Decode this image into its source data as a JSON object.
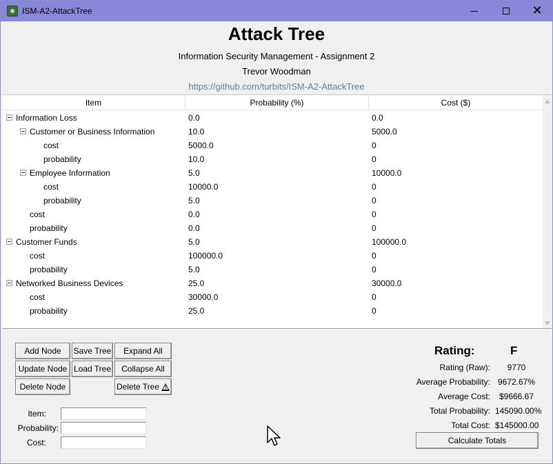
{
  "window": {
    "title": "ISM-A2-AttackTree"
  },
  "header": {
    "title": "Attack Tree",
    "subtitle": "Information Security Management - Assignment 2",
    "author": "Trevor Woodman",
    "link": "https://github.com/turbits/ISM-A2-AttackTree"
  },
  "tree": {
    "columns": [
      "Item",
      "Probability (%)",
      "Cost ($)"
    ],
    "rows": [
      {
        "item": "Information Loss",
        "prob": "0.0",
        "cost": "0.0",
        "level": 0,
        "expandable": true
      },
      {
        "item": "Customer or Business Information",
        "prob": "10.0",
        "cost": "5000.0",
        "level": 1,
        "expandable": true
      },
      {
        "item": "cost",
        "prob": "5000.0",
        "cost": "0",
        "level": 2,
        "expandable": false
      },
      {
        "item": "probability",
        "prob": "10.0",
        "cost": "0",
        "level": 2,
        "expandable": false
      },
      {
        "item": "Employee Information",
        "prob": "5.0",
        "cost": "10000.0",
        "level": 1,
        "expandable": true
      },
      {
        "item": "cost",
        "prob": "10000.0",
        "cost": "0",
        "level": 2,
        "expandable": false
      },
      {
        "item": "probability",
        "prob": "5.0",
        "cost": "0",
        "level": 2,
        "expandable": false
      },
      {
        "item": "cost",
        "prob": "0.0",
        "cost": "0",
        "level": 1,
        "expandable": false
      },
      {
        "item": "probability",
        "prob": "0.0",
        "cost": "0",
        "level": 1,
        "expandable": false
      },
      {
        "item": "Customer Funds",
        "prob": "5.0",
        "cost": "100000.0",
        "level": 0,
        "expandable": true
      },
      {
        "item": "cost",
        "prob": "100000.0",
        "cost": "0",
        "level": 1,
        "expandable": false
      },
      {
        "item": "probability",
        "prob": "5.0",
        "cost": "0",
        "level": 1,
        "expandable": false
      },
      {
        "item": "Networked Business Devices",
        "prob": "25.0",
        "cost": "30000.0",
        "level": 0,
        "expandable": true
      },
      {
        "item": "cost",
        "prob": "30000.0",
        "cost": "0",
        "level": 1,
        "expandable": false
      },
      {
        "item": "probability",
        "prob": "25.0",
        "cost": "0",
        "level": 1,
        "expandable": false
      }
    ]
  },
  "buttons": {
    "add_node": "Add Node",
    "save_tree": "Save Tree",
    "expand_all": "Expand All",
    "update_node": "Update Node",
    "load_tree": "Load Tree",
    "collapse_all": "Collapse All",
    "delete_node": "Delete Node",
    "delete_tree": "Delete Tree",
    "calculate_totals": "Calculate Totals"
  },
  "form": {
    "item_label": "Item:",
    "probability_label": "Probability:",
    "cost_label": "Cost:",
    "item_value": "",
    "probability_value": "",
    "cost_value": ""
  },
  "stats": {
    "rating_label": "Rating:",
    "rating_grade": "F",
    "rows": [
      {
        "label": "Rating (Raw):",
        "value": "9770"
      },
      {
        "label": "Average Probability:",
        "value": "9672.67%"
      },
      {
        "label": "Average Cost:",
        "value": "$9666.67"
      },
      {
        "label": "Total Probability:",
        "value": "145090.00%"
      },
      {
        "label": "Total Cost:",
        "value": "$145000.00"
      }
    ]
  },
  "icons": {
    "app": "app-icon",
    "minimize": "minimize-icon",
    "maximize": "maximize-icon",
    "close": "close-icon",
    "warning": "warning-icon",
    "collapse": "minus-box-icon",
    "cursor": "mouse-cursor-icon"
  },
  "colors": {
    "titlebar": "#8a86d8",
    "link": "#5a7f8f",
    "background": "#f0f0f0"
  }
}
